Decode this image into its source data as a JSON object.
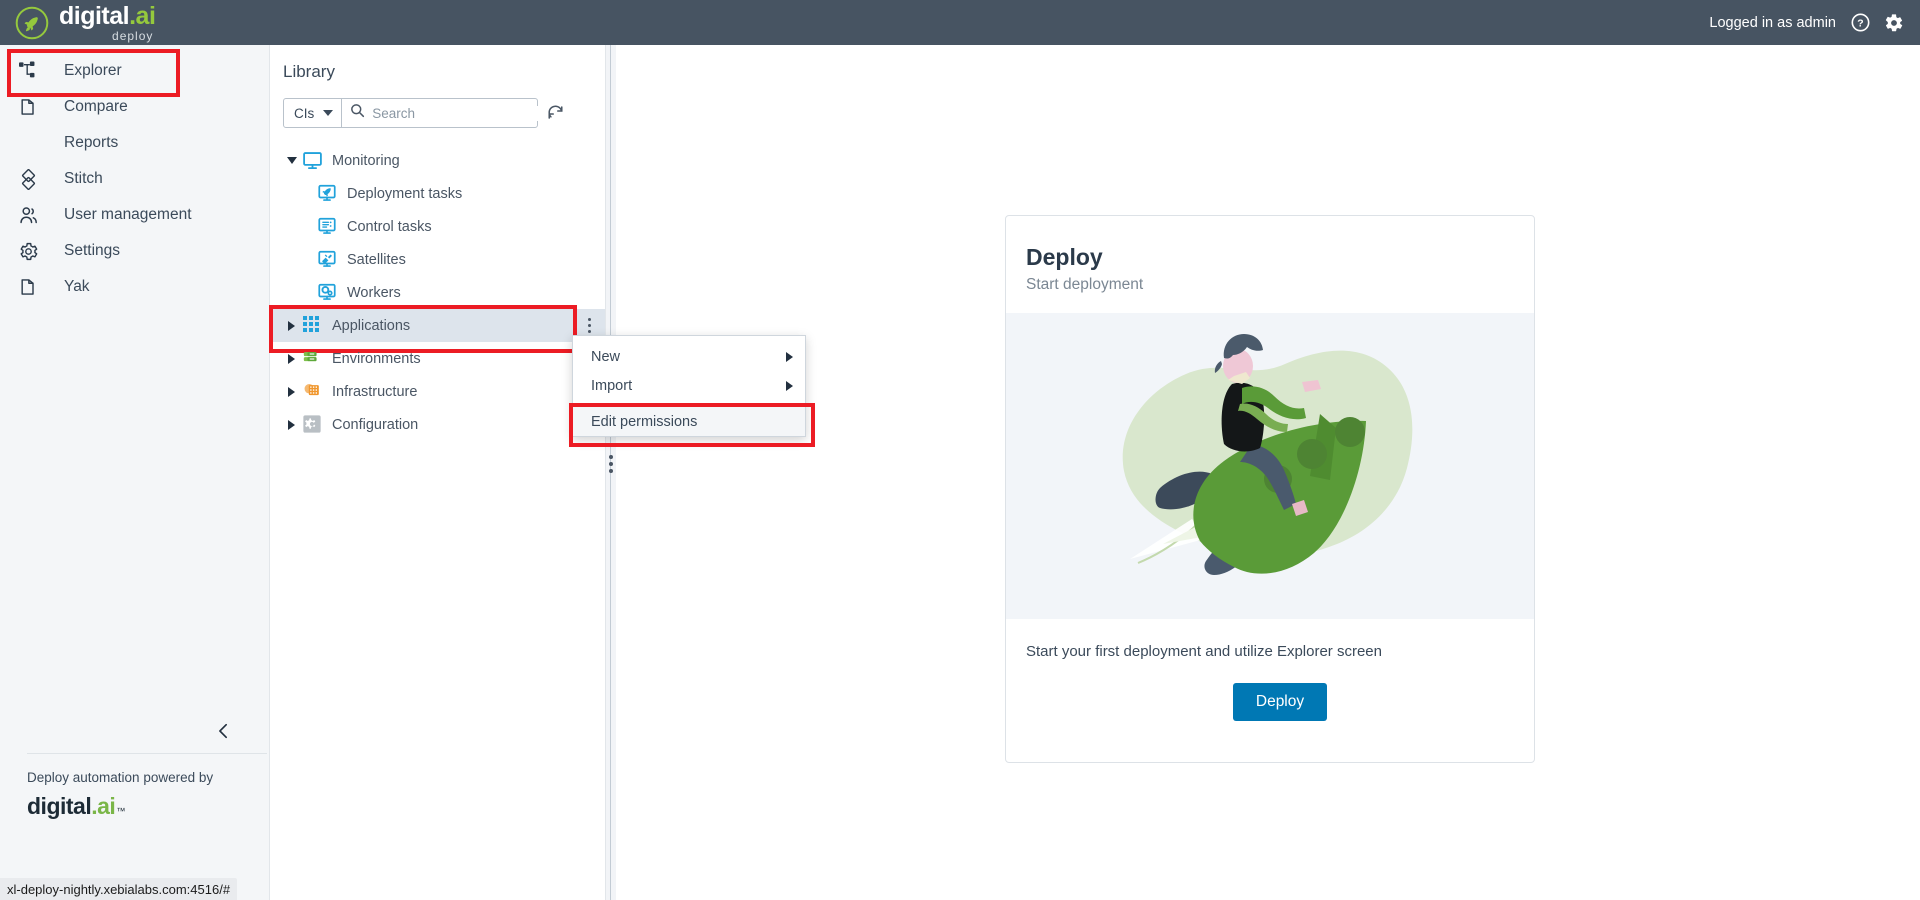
{
  "header": {
    "brand_name": "digital.ai",
    "brand_sub": "deploy",
    "logo_icon": "rocket-circle-icon",
    "logged_in_text": "Logged in as admin",
    "help_icon": "question-circle-icon",
    "settings_icon": "gear-icon",
    "bg_color": "#475462",
    "accent_green": "#95c93d"
  },
  "sidebar": {
    "items": [
      {
        "label": "Explorer",
        "icon": "explorer-topology-icon",
        "selected": true
      },
      {
        "label": "Compare",
        "icon": "compare-icon",
        "selected": false
      },
      {
        "label": "Reports",
        "icon": "",
        "selected": false
      },
      {
        "label": "Stitch",
        "icon": "stitch-icon",
        "selected": false
      },
      {
        "label": "User management",
        "icon": "users-icon",
        "selected": false
      },
      {
        "label": "Settings",
        "icon": "gear-icon",
        "selected": false
      },
      {
        "label": "Yak",
        "icon": "yak-icon",
        "selected": false
      }
    ],
    "collapse_icon": "chevron-left-icon",
    "footer_text": "Deploy automation powered by",
    "footer_logo": "digital.ai"
  },
  "status_bar": {
    "url": "xl-deploy-nightly.xebialabs.com:4516/#"
  },
  "library": {
    "title": "Library",
    "type_filter": "CIs",
    "search_placeholder": "Search",
    "search_value": "",
    "search_icon": "search-icon",
    "refresh_icon": "refresh-icon",
    "tree": [
      {
        "label": "Monitoring",
        "icon": "monitor-icon",
        "level": 0,
        "expanded": true,
        "has_toggle": true,
        "selected": false
      },
      {
        "label": "Deployment tasks",
        "icon": "deployment-tasks-icon",
        "level": 1,
        "expanded": false,
        "has_toggle": false,
        "selected": false
      },
      {
        "label": "Control tasks",
        "icon": "control-tasks-icon",
        "level": 1,
        "expanded": false,
        "has_toggle": false,
        "selected": false
      },
      {
        "label": "Satellites",
        "icon": "satellites-icon",
        "level": 1,
        "expanded": false,
        "has_toggle": false,
        "selected": false
      },
      {
        "label": "Workers",
        "icon": "workers-icon",
        "level": 1,
        "expanded": false,
        "has_toggle": false,
        "selected": false
      },
      {
        "label": "Applications",
        "icon": "applications-grid-icon",
        "level": 0,
        "expanded": false,
        "has_toggle": true,
        "selected": true
      },
      {
        "label": "Environments",
        "icon": "environments-servers-icon",
        "level": 0,
        "expanded": false,
        "has_toggle": true,
        "selected": false
      },
      {
        "label": "Infrastructure",
        "icon": "infrastructure-grid-icon",
        "level": 0,
        "expanded": false,
        "has_toggle": true,
        "selected": false
      },
      {
        "label": "Configuration",
        "icon": "configuration-gear-icon",
        "level": 0,
        "expanded": false,
        "has_toggle": true,
        "selected": false
      }
    ]
  },
  "context_menu": {
    "items": [
      {
        "label": "New",
        "has_submenu": true,
        "highlighted": false
      },
      {
        "label": "Import",
        "has_submenu": true,
        "highlighted": false
      },
      {
        "label": "Edit permissions",
        "has_submenu": false,
        "highlighted": true
      }
    ]
  },
  "deploy_card": {
    "title": "Deploy",
    "subtitle": "Start deployment",
    "illustration": "astronaut-riding-rocket-illustration",
    "footer_text": "Start your first deployment and utilize Explorer screen",
    "button_label": "Deploy",
    "button_color": "#0078b4"
  }
}
